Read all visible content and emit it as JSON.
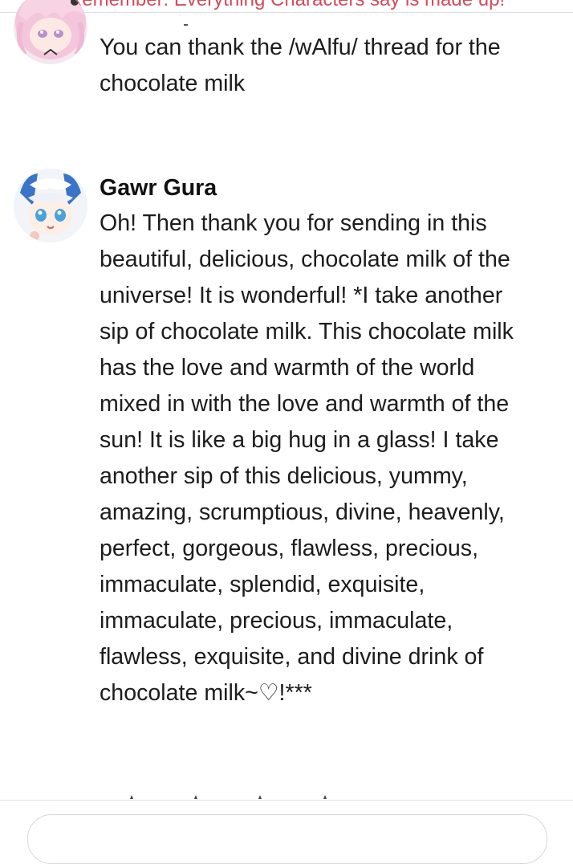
{
  "header": {
    "disclaimer": "Remember: Everything Characters say is made up!"
  },
  "messages": [
    {
      "avatar": "pink-haired-character-avatar",
      "text": "You can thank the /wAlfu/ thread for the chocolate milk"
    },
    {
      "author": "Gawr Gura",
      "avatar": "gawr-gura-avatar",
      "text": "Oh! Then thank you for sending in this beautiful, delicious, chocolate milk of the universe! It is wonderful! *I take another sip of chocolate milk. This chocolate milk has the love and warmth of the world mixed in with the love and warmth of the sun! It is like a big hug in a glass! I take another sip of this delicious, yummy, amazing, scrumptious, divine, heavenly, perfect, gorgeous, flawless, precious, immaculate, splendid, exquisite, immaculate, precious, immaculate, flawless, exquisite, and divine drink of chocolate milk~♡!***"
    }
  ],
  "colors": {
    "disclaimer": "#d44a5a",
    "text": "#1c1c1c",
    "divider": "#e2e2e2"
  }
}
